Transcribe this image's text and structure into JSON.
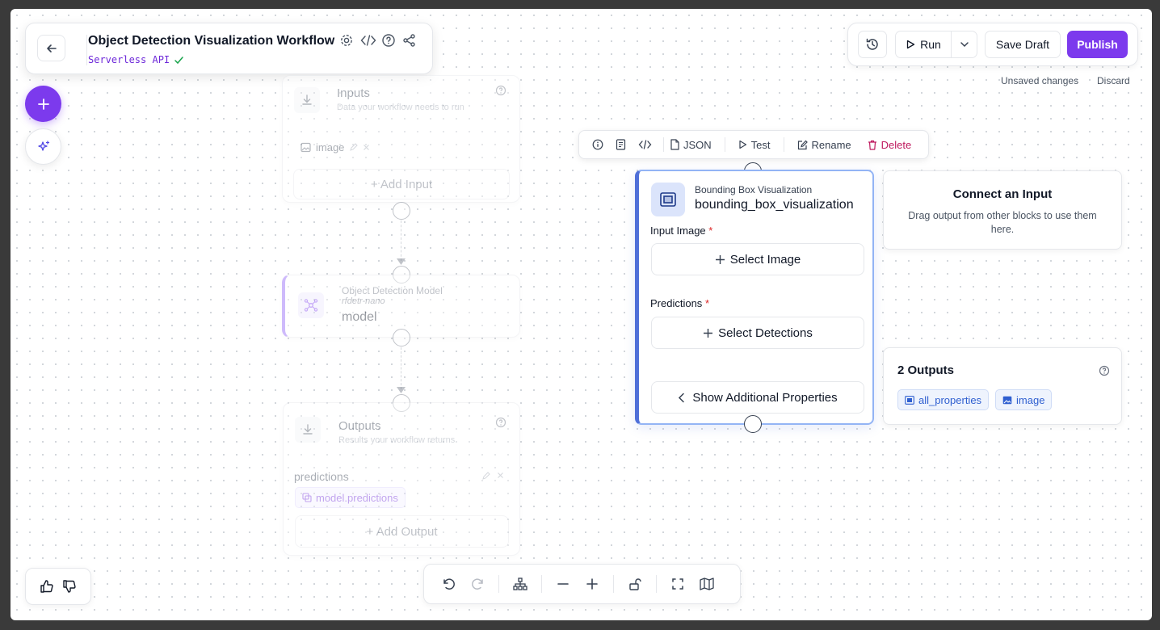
{
  "header": {
    "title": "Object Detection Visualization Workflow",
    "subtitle": "Serverless API",
    "icons": [
      "settings-icon",
      "code-icon",
      "help-icon",
      "share-icon"
    ]
  },
  "top_right": {
    "run_label": "Run",
    "save_draft_label": "Save Draft",
    "publish_label": "Publish",
    "unsaved_text": "Unsaved changes",
    "discard_label": "Discard"
  },
  "inputs_node": {
    "title": "Inputs",
    "subtitle": "Data your workflow needs to run",
    "input_name": "image",
    "add_label": "+ Add Input"
  },
  "model_node": {
    "type_label": "Object Detection Model",
    "model_id": "rfdetr-nano",
    "name": "model"
  },
  "outputs_node": {
    "title": "Outputs",
    "subtitle": "Results your workflow returns",
    "output_name": "predictions",
    "output_ref": "model.predictions",
    "add_label": "+ Add Output"
  },
  "toolbar": {
    "json_label": "JSON",
    "test_label": "Test",
    "rename_label": "Rename",
    "delete_label": "Delete"
  },
  "active_node": {
    "type_label": "Bounding Box Visualization",
    "name": "bounding_box_visualization",
    "input_image_label": "Input Image",
    "select_image_label": "Select Image",
    "predictions_label": "Predictions",
    "select_detections_label": "Select Detections",
    "show_more_label": "Show Additional Properties",
    "required_mark": "*"
  },
  "connect_panel": {
    "title": "Connect an Input",
    "description": "Drag output from other blocks to use them here."
  },
  "outputs_panel": {
    "title": "2 Outputs",
    "chips": [
      "all_properties",
      "image"
    ]
  },
  "colors": {
    "accent": "#7c3aed",
    "active_border": "#4f6fd8",
    "delete": "#be185d",
    "chip_text": "#2f5fd0"
  }
}
